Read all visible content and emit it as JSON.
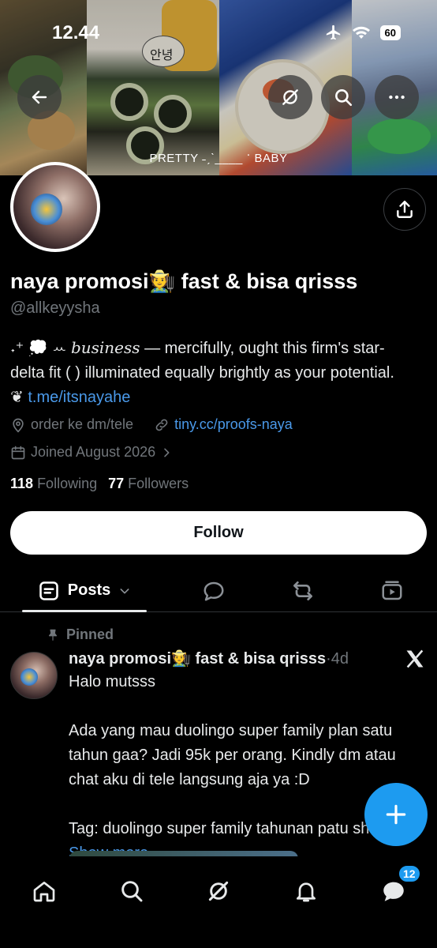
{
  "status_bar": {
    "time": "12.44",
    "battery": "60"
  },
  "banner": {
    "caption": "PRETTY ˗ˏˋ____ ॱ BABY",
    "sticker_text": "안녕"
  },
  "profile": {
    "display_name": "naya promosi🧑‍🌾 fast & bisa qrisss",
    "handle": "@allkeyysha",
    "bio_line1_prefix": "˖⁺ 💭 ꕀ ",
    "bio_line1_italic": "business",
    "bio_line1_rest": " — mercifully, ought this firm's star-",
    "bio_line2": "delta fit ( ) illuminated equally brightly as your potential.",
    "bio_line3_prefix": "❦ ",
    "bio_link": "t.me/itsnayahe",
    "location": "order ke dm/tele",
    "website": "tiny.cc/proofs-naya",
    "joined": "Joined August 2026",
    "following_count": "118",
    "following_label": "Following",
    "followers_count": "77",
    "followers_label": "Followers",
    "follow_button": "Follow"
  },
  "tabs": {
    "posts_label": "Posts"
  },
  "post": {
    "pinned_label": "Pinned",
    "author": "naya promosi🧑‍🌾 fast & bisa qrisss",
    "dot": " · ",
    "time": "4d",
    "body_text": "Halo mutsss\n\nAda yang mau duolingo super family plan satu tahun gaa? Jadi 95k per orang. Kindly dm atau chat aku di tele langsung aja ya :D\n\nTag: duolingo super family tahunan patu sharing ",
    "show_more": "Show more"
  },
  "nav": {
    "messages_badge": "12"
  },
  "colors": {
    "accent": "#1d9bf0",
    "link": "#4a99e9",
    "muted": "#71767b",
    "background": "#000000"
  },
  "icons": [
    "back-arrow-icon",
    "grok-icon",
    "search-icon",
    "more-icon",
    "share-icon",
    "location-icon",
    "link-icon",
    "calendar-icon",
    "chevron-right-icon",
    "posts-icon",
    "chevron-down-icon",
    "reply-icon",
    "repost-icon",
    "video-icon",
    "pin-icon",
    "x-logo-icon",
    "plus-icon",
    "home-icon",
    "notifications-icon",
    "messages-icon"
  ]
}
